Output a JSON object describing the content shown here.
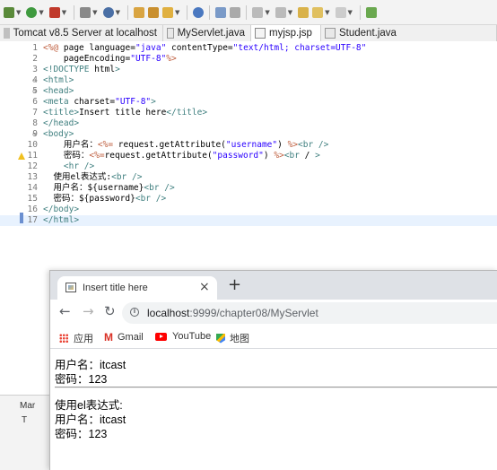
{
  "editor_tabs": [
    {
      "label": "Tomcat v8.5 Server at localhost",
      "active": false
    },
    {
      "label": "MyServlet.java",
      "active": false
    },
    {
      "label": "myjsp.jsp",
      "active": true
    },
    {
      "label": "Student.java",
      "active": false
    }
  ],
  "code_lines": [
    {
      "n": "1",
      "fold": "",
      "text": "<%@ page language=\"java\" contentType=\"text/html; charset=UTF-8\""
    },
    {
      "n": "2",
      "fold": "",
      "text": "    pageEncoding=\"UTF-8\"%>"
    },
    {
      "n": "3",
      "fold": "",
      "text": "<!DOCTYPE html>"
    },
    {
      "n": "4",
      "fold": "⊖",
      "text": "<html>"
    },
    {
      "n": "5",
      "fold": "⊖",
      "text": "<head>"
    },
    {
      "n": "6",
      "fold": "",
      "text": "<meta charset=\"UTF-8\">"
    },
    {
      "n": "7",
      "fold": "",
      "text": "<title>Insert title here</title>"
    },
    {
      "n": "8",
      "fold": "",
      "text": "</head>"
    },
    {
      "n": "9",
      "fold": "⊖",
      "text": "<body>"
    },
    {
      "n": "10",
      "fold": "",
      "text": "    用户名：<%= request.getAttribute(\"username\") %><br />"
    },
    {
      "n": "11",
      "fold": "",
      "text": "    密码：<%=request.getAttribute(\"password\") %><br / >"
    },
    {
      "n": "12",
      "fold": "",
      "text": "    <hr />"
    },
    {
      "n": "13",
      "fold": "",
      "text": "  使用el表达式:<br />"
    },
    {
      "n": "14",
      "fold": "",
      "text": "  用户名：${username}<br />"
    },
    {
      "n": "15",
      "fold": "",
      "text": "  密码：${password}<br />"
    },
    {
      "n": "16",
      "fold": "",
      "text": "</body>"
    },
    {
      "n": "17",
      "fold": "",
      "text": "</html>"
    }
  ],
  "side_panel": {
    "tab_label": "Mar",
    "row_label": "T"
  },
  "browser": {
    "tab_title": "Insert title here",
    "close_glyph": "×",
    "newtab_glyph": "+",
    "url_host": "localhost",
    "url_rest": ":9999/chapter08/MyServlet",
    "bookmarks": [
      "应用",
      "Gmail",
      "YouTube",
      "地图"
    ],
    "page_lines": [
      "用户名：itcast",
      "密码：123",
      "使用el表达式:",
      "用户名：itcast",
      "密码：123"
    ]
  }
}
